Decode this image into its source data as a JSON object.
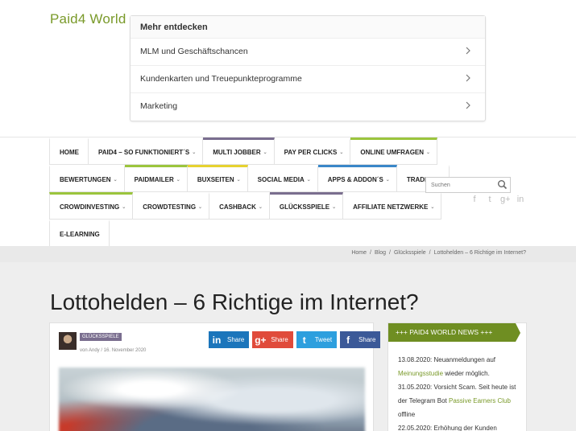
{
  "site": {
    "logo": "Paid4 World"
  },
  "discover": {
    "title": "Mehr entdecken",
    "items": [
      {
        "label": "MLM und Geschäftschancen"
      },
      {
        "label": "Kundenkarten und Treuepunkteprogramme"
      },
      {
        "label": "Marketing"
      }
    ]
  },
  "nav": {
    "rows": [
      [
        {
          "label": "HOME",
          "caret": ""
        },
        {
          "label": "PAID4 – SO FUNKTIONIERT´S",
          "caret": "⌄"
        },
        {
          "label": "MULTI JOBBER",
          "caret": "⌄"
        },
        {
          "label": "PAY PER CLICKS",
          "caret": "⌄"
        },
        {
          "label": "ONLINE UMFRAGEN",
          "caret": "⌄"
        }
      ],
      [
        {
          "label": "BEWERTUNGEN",
          "caret": "⌄"
        },
        {
          "label": "PAIDMAILER",
          "caret": "⌄"
        },
        {
          "label": "BUXSEITEN",
          "caret": "⌄"
        },
        {
          "label": "SOCIAL MEDIA",
          "caret": "⌄"
        },
        {
          "label": "APPS & ADDON´S",
          "caret": "⌄"
        },
        {
          "label": "TRADING",
          "caret": "⌄"
        }
      ],
      [
        {
          "label": "CROWDINVESTING",
          "caret": "⌄"
        },
        {
          "label": "CROWDTESTING",
          "caret": "⌄"
        },
        {
          "label": "CASHBACK",
          "caret": "⌄"
        },
        {
          "label": "GLÜCKSSPIELE",
          "caret": "⌄"
        },
        {
          "label": "AFFILIATE NETZWERKE",
          "caret": "⌄"
        }
      ],
      [
        {
          "label": "E-LEARNING",
          "caret": ""
        }
      ]
    ]
  },
  "search": {
    "placeholder": "Suchen"
  },
  "social": {
    "icons": [
      "f",
      "t",
      "g+",
      "in"
    ]
  },
  "breadcrumb": {
    "items": [
      "Home",
      "Blog",
      "Glücksspiele",
      "Lottohelden – 6 Richtige im Internet?"
    ],
    "separator": "/"
  },
  "article": {
    "title": "Lottohelden – 6 Richtige im Internet?",
    "category": "GLÜCKSSPIELE",
    "meta": "von Andy / 16. November 2020"
  },
  "share": {
    "linkedin": {
      "icon": "in",
      "label": "Share"
    },
    "googleplus": {
      "icon": "g+",
      "label": "Share"
    },
    "twitter": {
      "icon": "t",
      "label": "Tweet"
    },
    "facebook": {
      "icon": "f",
      "label": "Share"
    }
  },
  "sidebar": {
    "title": "+++ PAID4 WORLD NEWS +++",
    "news": [
      {
        "pre": "13.08.2020: Neuanmeldungen auf ",
        "link": "Meinungsstudie",
        "post": " wieder möglich."
      },
      {
        "pre": "31.05.2020: Vorsicht Scam. Seit heute ist der Telegram Bot ",
        "link": "Passive Earners Club",
        "post": " offline"
      },
      {
        "pre": "22.05.2020: Erhöhung der Kunden",
        "link": "",
        "post": ""
      }
    ]
  },
  "colors": {
    "accent": "#6f8e22",
    "logo": "#7a9a2a",
    "purple": "#7a6e8f",
    "green": "#9bc53d",
    "yellow": "#e6d22f",
    "blue": "#3a87c8"
  }
}
